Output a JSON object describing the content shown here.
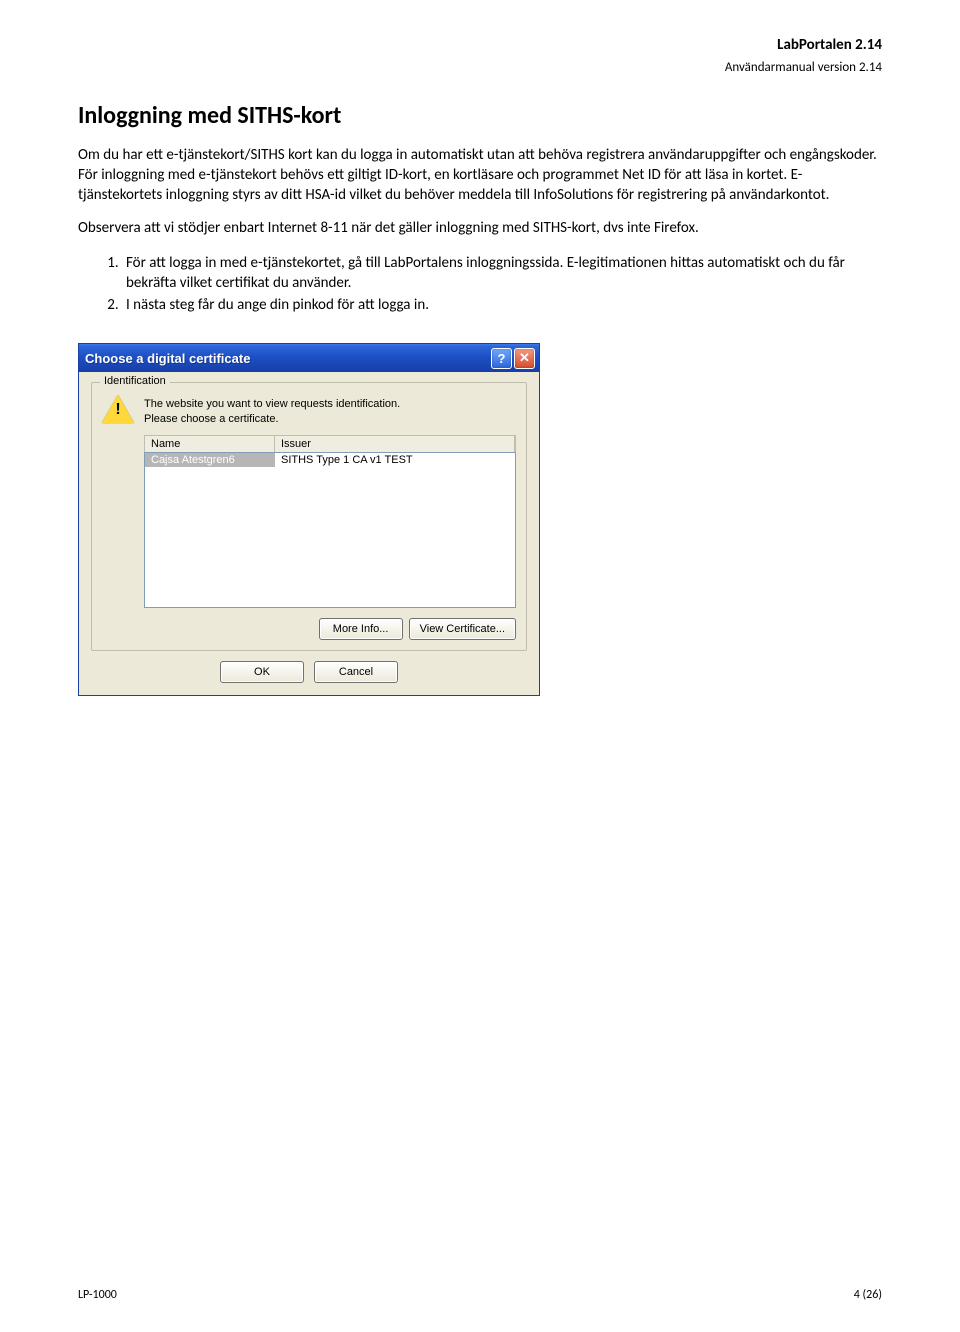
{
  "header": {
    "title": "LabPortalen 2.14",
    "subtitle": "Användarmanual version 2.14"
  },
  "doc": {
    "h1": "Inloggning med SITHS-kort",
    "p1": "Om du har ett e-tjänstekort/SITHS kort kan du logga in automatiskt utan att behöva registrera användaruppgifter och engångskoder. För inloggning med e-tjänstekort behövs ett giltigt ID-kort, en kortläsare och programmet Net ID för att läsa in kortet. E-tjänstekortets inloggning styrs av ditt HSA-id vilket du behöver meddela till InfoSolutions för registrering på användarkontot.",
    "p2": "Observera att vi stödjer enbart Internet 8-11 när det gäller inloggning med SITHS-kort, dvs inte Firefox.",
    "li1": "För att logga in med e-tjänstekortet, gå till LabPortalens inloggningssida. E-legitimationen hittas automatiskt och du får bekräfta vilket certifikat du använder.",
    "li2": "I nästa steg får du ange din pinkod för att logga in."
  },
  "dialog": {
    "title": "Choose a digital certificate",
    "group_legend": "Identification",
    "msg1": "The website you want to view requests identification.",
    "msg2": "Please choose a certificate.",
    "col_name": "Name",
    "col_issuer": "Issuer",
    "row_name": "Cajsa Atestgren6",
    "row_issuer": "SITHS Type 1 CA v1 TEST",
    "more_info": "More Info...",
    "view_cert": "View Certificate...",
    "ok": "OK",
    "cancel": "Cancel"
  },
  "footer": {
    "left": "LP-1000",
    "right": "4 (26)"
  }
}
